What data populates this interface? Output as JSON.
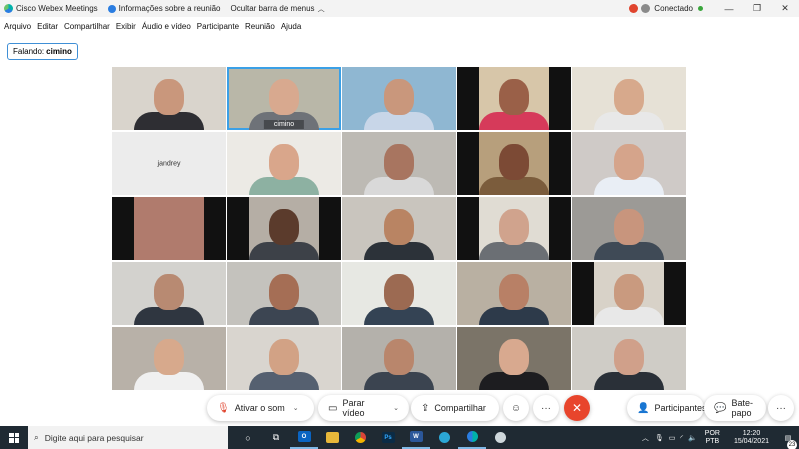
{
  "titlebar": {
    "app_name": "Cisco Webex Meetings",
    "meeting_info": "Informações sobre a reunião",
    "hide_menu": "Ocultar barra de menus",
    "status": "Conectado",
    "minimize": "—",
    "restore": "❐",
    "close": "✕"
  },
  "menu": [
    "Arquivo",
    "Editar",
    "Compartilhar",
    "Exibir",
    "Áudio e vídeo",
    "Participante",
    "Reunião",
    "Ajuda"
  ],
  "speaking": {
    "label": "Falando:",
    "name": "cimino"
  },
  "tiles": [
    {
      "name": "",
      "bg": "#d9d4cc",
      "skin": "#c9977c",
      "shirt": "#2e2e33"
    },
    {
      "name": "cimino",
      "bg": "#b9b7a8",
      "skin": "#d8a98f",
      "shirt": "#6e7278",
      "active": true
    },
    {
      "name": "",
      "bg": "#8fb7d2",
      "skin": "#c9977c",
      "shirt": "#c8d6e8"
    },
    {
      "name": "",
      "bg": "#d7c6a9",
      "skin": "#9a6048",
      "shirt": "#d63a5a",
      "bars": true
    },
    {
      "name": "",
      "bg": "#e6e1d6",
      "skin": "#d7a98c",
      "shirt": "#e8e8e8"
    },
    {
      "name": "jandrey",
      "blank": true
    },
    {
      "name": "",
      "bg": "#eceae5",
      "skin": "#d9a68b",
      "shirt": "#8db1a2"
    },
    {
      "name": "",
      "bg": "#bdbab4",
      "skin": "#a87560",
      "shirt": "#d9d9d9"
    },
    {
      "name": "",
      "bg": "#b79f7c",
      "skin": "#7c4a35",
      "shirt": "#7b5c3c",
      "bars": true
    },
    {
      "name": "",
      "bg": "#cfcac7",
      "skin": "#d5a48b",
      "shirt": "#e9eef5"
    },
    {
      "name": "",
      "bg": "#b07b6d",
      "skin": "#a0695a",
      "shirt": "#b07b6d",
      "bars": true,
      "empty": true
    },
    {
      "name": "",
      "bg": "#b5aea5",
      "skin": "#5b3b2c",
      "shirt": "#3d4148",
      "bars": true
    },
    {
      "name": "",
      "bg": "#c9c5be",
      "skin": "#b98463",
      "shirt": "#2c3239"
    },
    {
      "name": "",
      "bg": "#e0dcd3",
      "skin": "#d0a38d",
      "shirt": "#6b6f74",
      "bars": true
    },
    {
      "name": "",
      "bg": "#9c9a96",
      "skin": "#c8957d",
      "shirt": "#3f4a56"
    },
    {
      "name": "",
      "bg": "#d3d2ce",
      "skin": "#b88a72",
      "shirt": "#2f3640"
    },
    {
      "name": "",
      "bg": "#c4c2bd",
      "skin": "#a56e55",
      "shirt": "#3c4552"
    },
    {
      "name": "",
      "bg": "#e7e8e3",
      "skin": "#9c6a52",
      "shirt": "#344354"
    },
    {
      "name": "",
      "bg": "#b9b0a2",
      "skin": "#b88066",
      "shirt": "#2d3a4a"
    },
    {
      "name": "",
      "bg": "#d8d2c8",
      "skin": "#c99a7f",
      "shirt": "#e8e8e8",
      "bars": true
    },
    {
      "name": "",
      "bg": "#b8b1a8",
      "skin": "#d7a98c",
      "shirt": "#f0f0f0"
    },
    {
      "name": "",
      "bg": "#d9d5cf",
      "skin": "#d2a285",
      "shirt": "#556070"
    },
    {
      "name": "",
      "bg": "#b4b1ab",
      "skin": "#b9866c",
      "shirt": "#3b4450"
    },
    {
      "name": "",
      "bg": "#7b7468",
      "skin": "#d8a98f",
      "shirt": "#1d1d20"
    },
    {
      "name": "",
      "bg": "#cfccc6",
      "skin": "#d0a08a",
      "shirt": "#2a3038"
    }
  ],
  "controls": {
    "audio": "Ativar o som",
    "video": "Parar vídeo",
    "share": "Compartilhar",
    "participants": "Participantes",
    "chat": "Bate-papo",
    "more": "···",
    "end": "✕",
    "reactions": "☺"
  },
  "taskbar": {
    "search_placeholder": "Digite aqui para pesquisar",
    "lang_top": "POR",
    "lang_bottom": "PTB",
    "time": "12:20",
    "date": "15/04/2021",
    "notif_count": "23"
  }
}
